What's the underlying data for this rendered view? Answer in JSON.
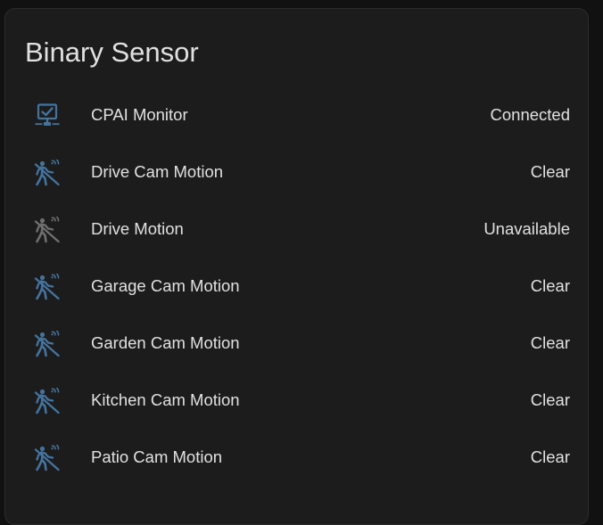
{
  "card": {
    "title": "Binary Sensor"
  },
  "colors": {
    "icon_active": "#44739e",
    "icon_unavailable": "#6f6f6f",
    "card_background": "#1c1c1c",
    "page_background": "#111111",
    "text_primary": "#e1e1e1"
  },
  "entities": [
    {
      "name": "CPAI Monitor",
      "state": "Connected",
      "icon": "network-check-icon",
      "available": true
    },
    {
      "name": "Drive Cam Motion",
      "state": "Clear",
      "icon": "motion-sensor-off-icon",
      "available": true
    },
    {
      "name": "Drive Motion",
      "state": "Unavailable",
      "icon": "motion-sensor-off-icon",
      "available": false
    },
    {
      "name": "Garage Cam Motion",
      "state": "Clear",
      "icon": "motion-sensor-off-icon",
      "available": true
    },
    {
      "name": "Garden Cam Motion",
      "state": "Clear",
      "icon": "motion-sensor-off-icon",
      "available": true
    },
    {
      "name": "Kitchen Cam Motion",
      "state": "Clear",
      "icon": "motion-sensor-off-icon",
      "available": true
    },
    {
      "name": "Patio Cam Motion",
      "state": "Clear",
      "icon": "motion-sensor-off-icon",
      "available": true
    }
  ]
}
